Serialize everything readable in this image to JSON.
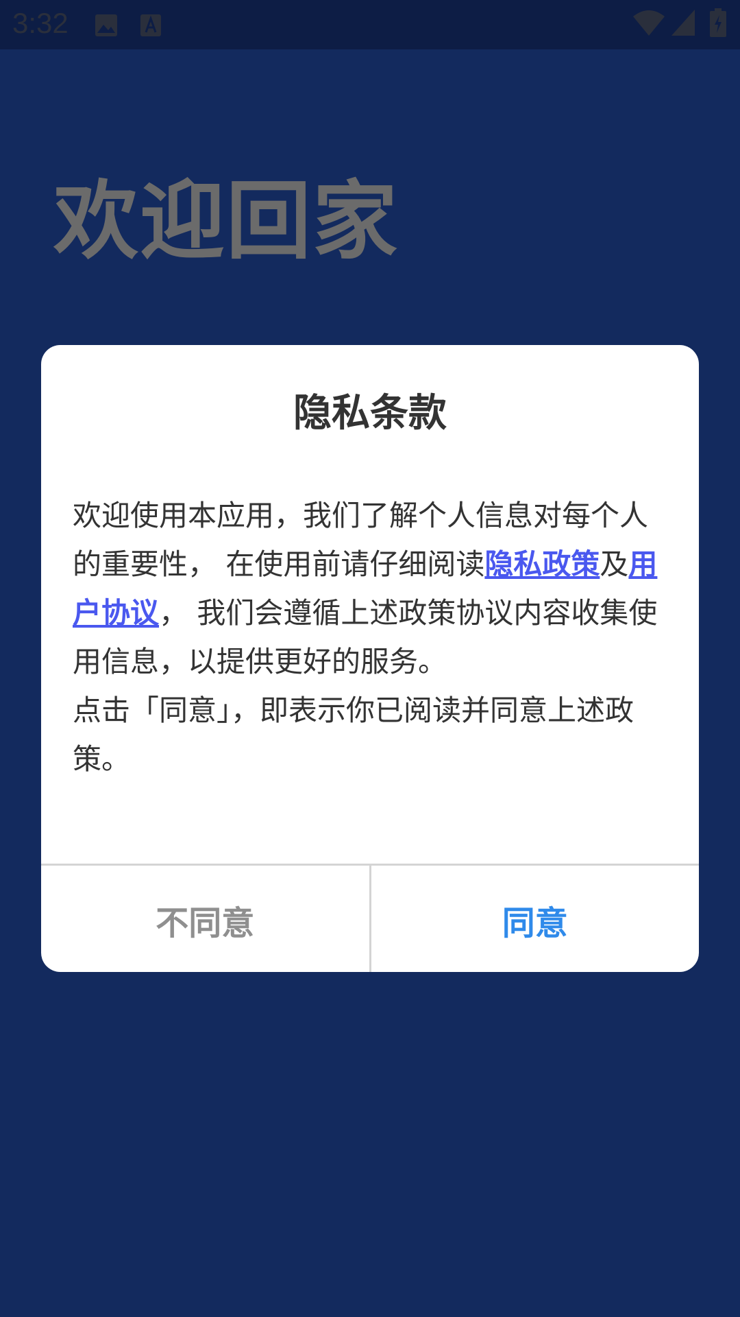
{
  "status_bar": {
    "time": "3:32",
    "icons": [
      "image-icon",
      "text-a-icon",
      "wifi-icon",
      "signal-icon",
      "battery-icon"
    ]
  },
  "welcome_title": "欢迎回家",
  "dialog": {
    "title": "隐私条款",
    "body_line1_prefix": "欢迎使用本应用，我们了解个人信息对每个人的重要性， 在使用前请仔细阅读",
    "privacy_link": "隐私政策",
    "connector": "及",
    "user_agreement_link": "用户协议",
    "body_line1_suffix": "， 我们会遵循上述政策协议内容收集使用信息，以提供更好的服务。",
    "body_line2": "点击「同意」，即表示你已阅读并同意上述政策。",
    "disagree_label": "不同意",
    "agree_label": "同意"
  },
  "colors": {
    "background": "#132a5e",
    "status_bar": "#0d1d45",
    "link": "#4a58ef",
    "agree": "#2f8aea",
    "disagree": "#8f8f8f"
  }
}
